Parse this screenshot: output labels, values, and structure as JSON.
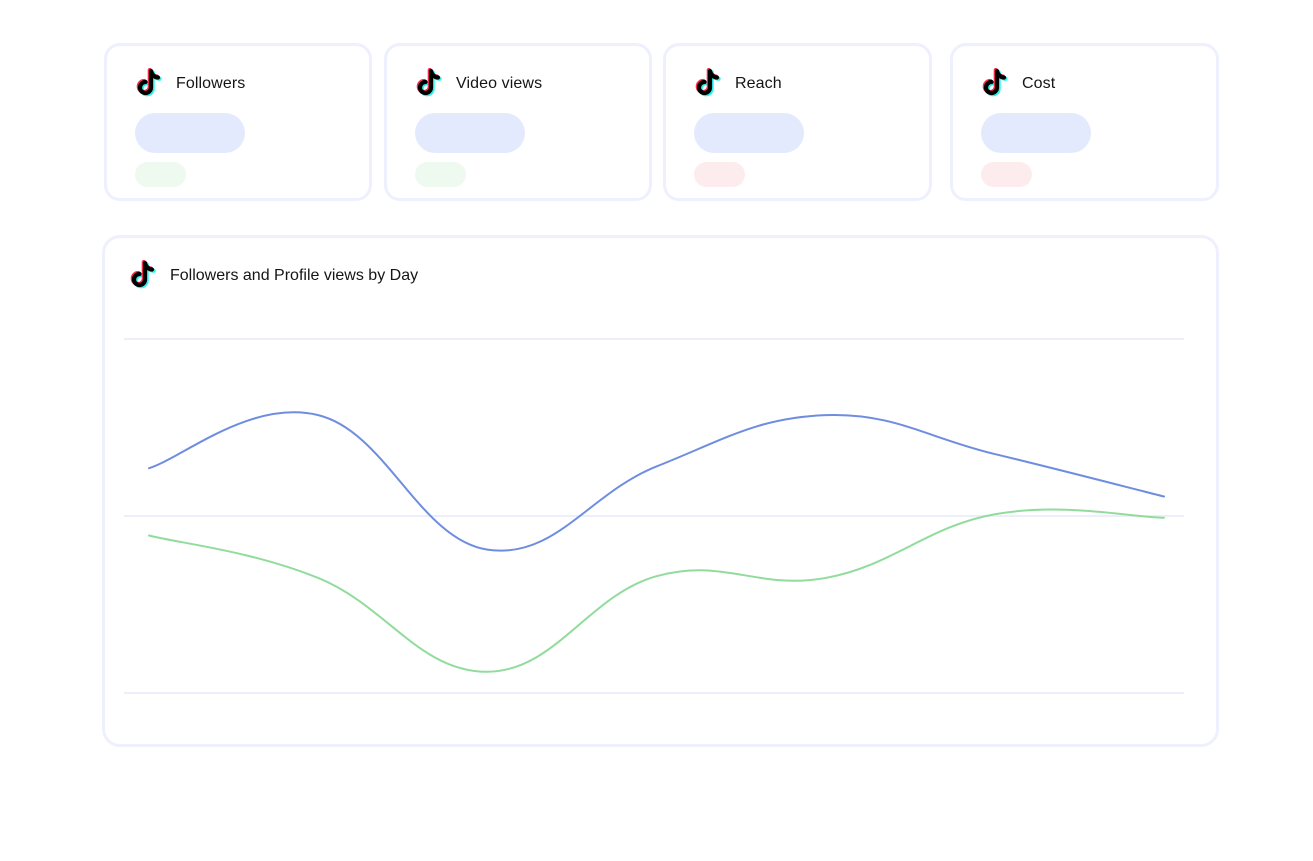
{
  "cards": [
    {
      "title": "Followers",
      "icon": "tiktok-icon",
      "trend": "up"
    },
    {
      "title": "Video views",
      "icon": "tiktok-icon",
      "trend": "up"
    },
    {
      "title": "Reach",
      "icon": "tiktok-icon",
      "trend": "down"
    },
    {
      "title": "Cost",
      "icon": "tiktok-icon",
      "trend": "down"
    }
  ],
  "colors": {
    "card_border": "#eef0fd",
    "value_placeholder": "#e4eafe",
    "trend_up": "#eef9ef",
    "trend_down": "#fdeced",
    "series_blue": "#6f8de0",
    "series_green": "#91dc9c",
    "gridline": "#eceefb"
  },
  "chart": {
    "title": "Followers and Profile views by Day",
    "icon": "tiktok-icon"
  },
  "chart_data": {
    "type": "line",
    "title": "Followers and Profile views by Day",
    "xlabel": "",
    "ylabel": "",
    "x": [
      1,
      2,
      3,
      4,
      5,
      6,
      7
    ],
    "ylim": [
      0,
      2
    ],
    "grid": true,
    "legend": "none",
    "series": [
      {
        "color": "#6f8de0",
        "values": [
          1.27,
          1.57,
          0.81,
          1.28,
          1.57,
          1.35,
          1.11
        ]
      },
      {
        "color": "#91dc9c",
        "values": [
          0.89,
          0.65,
          0.12,
          0.66,
          0.65,
          1.01,
          0.99
        ]
      }
    ]
  }
}
